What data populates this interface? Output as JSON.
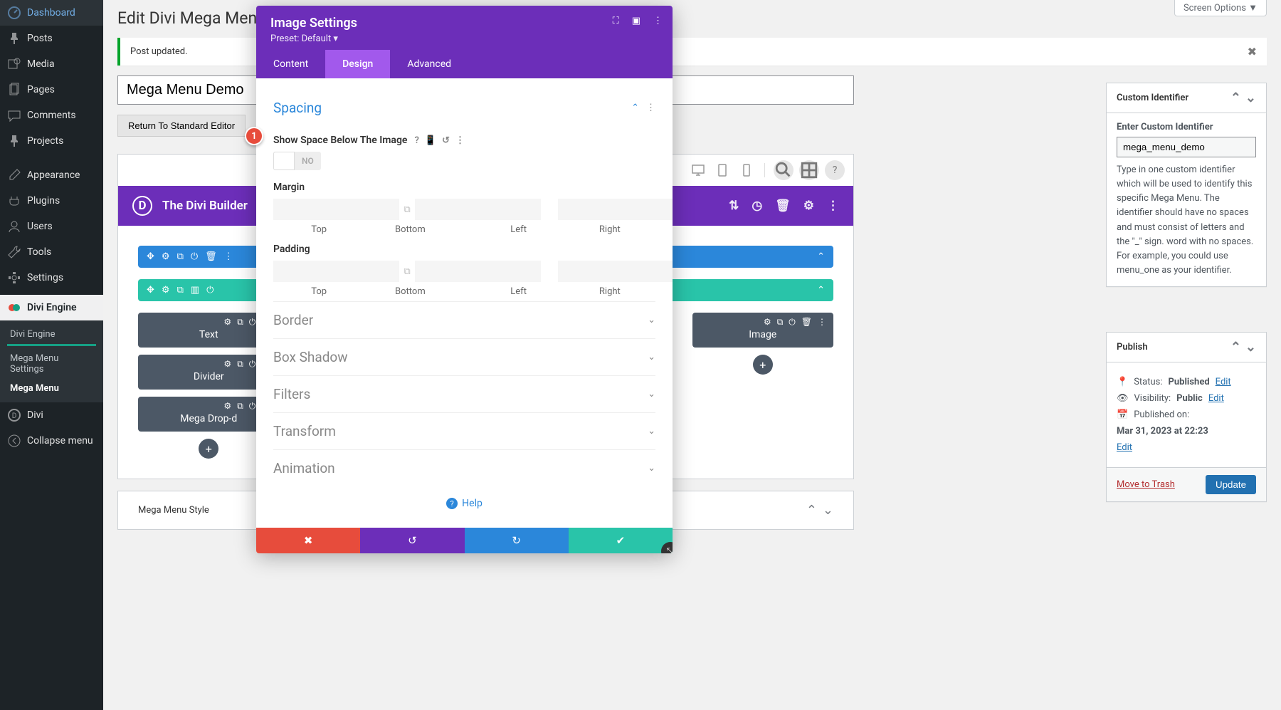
{
  "screen_options": "Screen Options ▼",
  "page_title": "Edit Divi Mega Menu",
  "notice_text": "Post updated.",
  "title_value": "Mega Menu Demo",
  "return_btn": "Return To Standard Editor",
  "badge_num": "1",
  "sidebar": {
    "items": [
      {
        "label": "Dashboard",
        "icon": "dashboard"
      },
      {
        "label": "Posts",
        "icon": "pin"
      },
      {
        "label": "Media",
        "icon": "media"
      },
      {
        "label": "Pages",
        "icon": "pages"
      },
      {
        "label": "Comments",
        "icon": "comments"
      },
      {
        "label": "Projects",
        "icon": "pin"
      },
      {
        "label": "Appearance",
        "icon": "brush"
      },
      {
        "label": "Plugins",
        "icon": "plug"
      },
      {
        "label": "Users",
        "icon": "user"
      },
      {
        "label": "Tools",
        "icon": "wrench"
      },
      {
        "label": "Settings",
        "icon": "gear"
      }
    ],
    "active_parent": "Divi Engine",
    "sub_items": [
      "Divi Engine",
      "Mega Menu Settings",
      "Mega Menu"
    ],
    "sub_active": "Mega Menu",
    "bottom_items": [
      "Divi",
      "Collapse menu"
    ]
  },
  "builder": {
    "header_title": "The Divi Builder",
    "modules_left": [
      "Text",
      "Divider",
      "Mega Drop-d"
    ],
    "module_right": "Image",
    "style_title": "Mega Menu Style"
  },
  "modal": {
    "title": "Image Settings",
    "preset": "Preset: Default ▾",
    "tabs": [
      "Content",
      "Design",
      "Advanced"
    ],
    "active_tab": "Design",
    "section_open": "Spacing",
    "field_show_space": "Show Space Below The Image",
    "toggle_label": "NO",
    "margin_label": "Margin",
    "padding_label": "Padding",
    "dir_labels": [
      "Top",
      "Bottom",
      "Left",
      "Right"
    ],
    "closed_sections": [
      "Border",
      "Box Shadow",
      "Filters",
      "Transform",
      "Animation"
    ],
    "help": "Help"
  },
  "meta_identifier": {
    "title": "Custom Identifier",
    "field_label": "Enter Custom Identifier",
    "value": "mega_menu_demo",
    "description": "Type in one custom identifier which will be used to identify this specific Mega Menu. The identifier should have no spaces and must consist of letters and the \"_\" sign. word with no spaces. For example, you could use menu_one as your identifier."
  },
  "meta_publish": {
    "title": "Publish",
    "status_label": "Status:",
    "status_value": "Published",
    "visibility_label": "Visibility:",
    "visibility_value": "Public",
    "published_label": "Published on:",
    "published_value": "Mar 31, 2023 at 22:23",
    "edit": "Edit",
    "trash": "Move to Trash",
    "update": "Update"
  }
}
